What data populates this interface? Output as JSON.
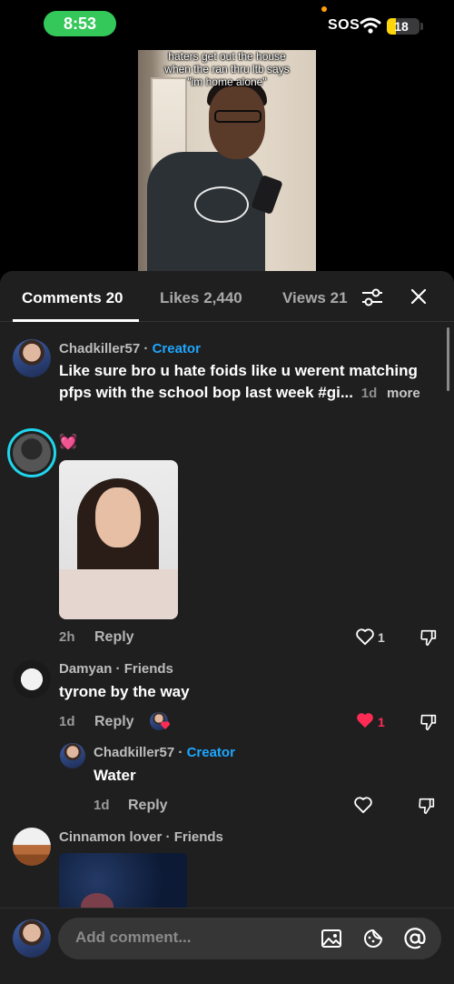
{
  "status_bar": {
    "time": "8:53",
    "carrier": "SOS",
    "battery": "18",
    "battery_level": 0.18
  },
  "video": {
    "caption_lines": [
      "haters get out the house",
      "when the ran thru ltb says",
      "\"im home alone\""
    ]
  },
  "tabs": [
    {
      "label": "Comments 20",
      "active": true
    },
    {
      "label": "Likes 2,440",
      "active": false
    },
    {
      "label": "Views 21",
      "active": false
    }
  ],
  "comments": [
    {
      "username": "Chadkiller57",
      "sep": "·",
      "tag": "Creator",
      "line1": "Like sure bro u hate foids like u werent matching",
      "line2": "pfps with the school bop last week #gi...",
      "time": "1d",
      "more": "more"
    },
    {
      "emoji": "💓",
      "time": "2h",
      "reply": "Reply",
      "likes": "1"
    },
    {
      "username": "Damyan",
      "sep": "·",
      "tag": "Friends",
      "text": "tyrone by the way",
      "time": "1d",
      "reply": "Reply",
      "likes": "1",
      "liked": true,
      "reply_item": {
        "username": "Chadkiller57",
        "sep": "·",
        "tag": "Creator",
        "text": "Water",
        "time": "1d",
        "reply": "Reply"
      }
    },
    {
      "username": "Cinnamon lover",
      "sep": "·",
      "tag": "Friends"
    }
  ],
  "composer": {
    "placeholder": "Add comment..."
  },
  "colors": {
    "accent_creator": "#1ea7ff",
    "like_red": "#fe2c55",
    "sheet_bg": "#1f1f1f",
    "status_green": "#34c759"
  }
}
